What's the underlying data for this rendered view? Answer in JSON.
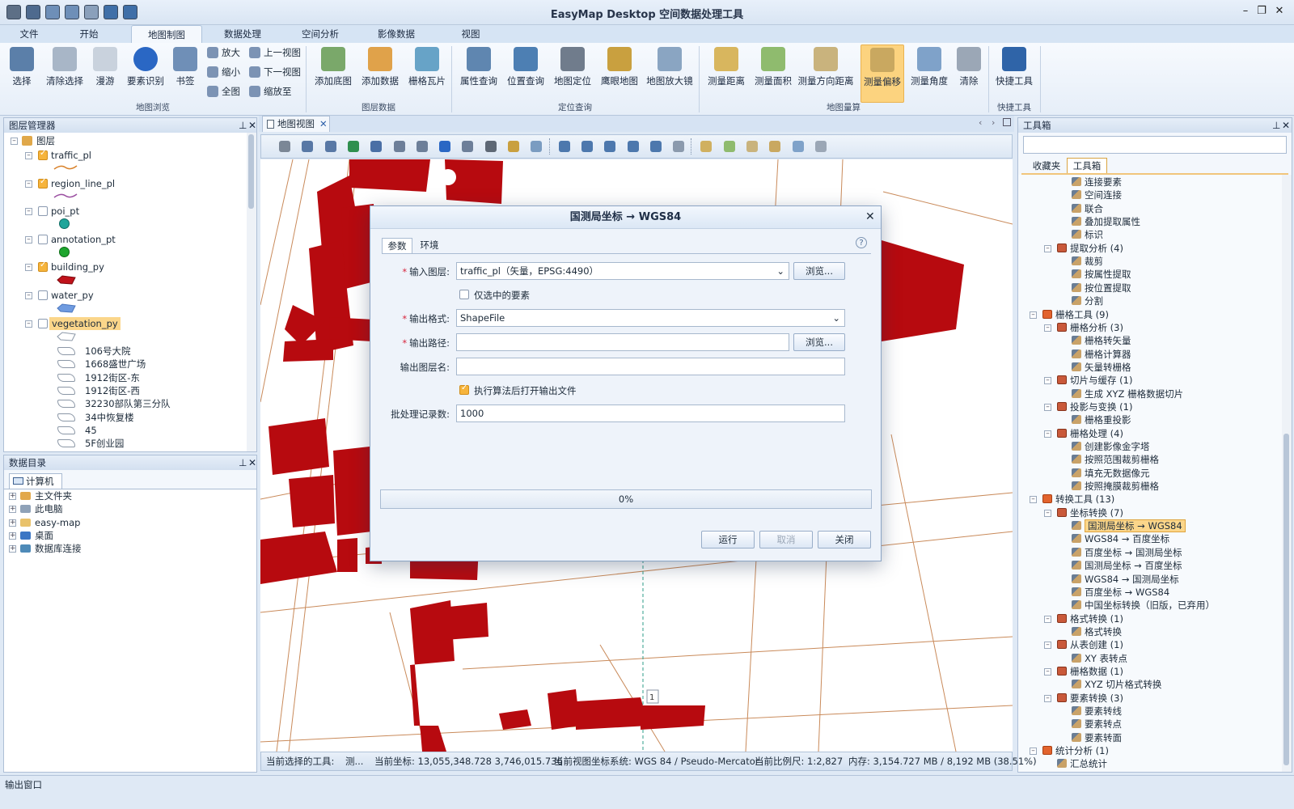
{
  "app": {
    "title": "EasyMap Desktop 空间数据处理工具"
  },
  "ribbon_tabs": [
    "文件",
    "开始",
    "地图制图",
    "数据处理",
    "空间分析",
    "影像数据",
    "视图"
  ],
  "ribbon": {
    "browse_buttons": [
      "选择",
      "清除选择",
      "漫游",
      "要素识别",
      "书签"
    ],
    "small_a": [
      "放大",
      "缩小",
      "全图"
    ],
    "small_b": [
      "上一视图",
      "下一视图",
      "缩放至"
    ],
    "browse_group": "地图浏览",
    "layer_buttons": [
      "添加底图",
      "添加数据",
      "栅格瓦片"
    ],
    "layer_group": "图层数据",
    "locate_buttons": [
      "属性查询",
      "位置查询",
      "地图定位",
      "鹰眼地图",
      "地图放大镜"
    ],
    "locate_group": "定位查询",
    "measure_buttons": [
      "测量距离",
      "测量面积",
      "测量方向距离",
      "测量偏移",
      "测量角度",
      "清除"
    ],
    "measure_group": "地图量算",
    "quick_button": "快捷工具",
    "quick_group": "快捷工具"
  },
  "layer_manager": {
    "title": "图层管理器",
    "root": "图层",
    "layers": [
      "traffic_pl",
      "region_line_pl",
      "poi_pt",
      "annotation_pt",
      "building_py",
      "water_py",
      "vegetation_py"
    ],
    "veg_items": [
      "106号大院",
      "1668盛世广场",
      "1912街区-东",
      "1912街区-西",
      "32230部队第三分队",
      "34中恢复楼",
      "45",
      "5F创业园"
    ]
  },
  "data_catalog": {
    "title": "数据目录",
    "tab": "计算机",
    "items": [
      "主文件夹",
      "此电脑",
      "easy-map",
      "桌面",
      "数据库连接"
    ]
  },
  "map_view": {
    "tab": "地图视图",
    "marker": "1"
  },
  "dialog": {
    "title": "国测局坐标 → WGS84",
    "tabs": [
      "参数",
      "环境"
    ],
    "input_layer_label": "输入图层:",
    "input_layer_value": "traffic_pl（矢量，EPSG:4490）",
    "browse": "浏览...",
    "only_selected": "仅选中的要素",
    "output_format_label": "输出格式:",
    "output_format_value": "ShapeFile",
    "output_path_label": "输出路径:",
    "output_name_label": "输出图层名:",
    "open_after": "执行算法后打开输出文件",
    "batch_label": "批处理记录数:",
    "batch_value": "1000",
    "progress": "0%",
    "run": "运行",
    "cancel": "取消",
    "close": "关闭"
  },
  "toolbox": {
    "title": "工具箱",
    "tabs": [
      "收藏夹",
      "工具箱"
    ],
    "rows": [
      {
        "level": 3,
        "type": "tool",
        "label": "连接要素"
      },
      {
        "level": 3,
        "type": "tool",
        "label": "空间连接"
      },
      {
        "level": 3,
        "type": "tool",
        "label": "联合"
      },
      {
        "level": 3,
        "type": "tool",
        "label": "叠加提取属性"
      },
      {
        "level": 3,
        "type": "tool",
        "label": "标识"
      },
      {
        "level": 2,
        "type": "group",
        "label": "提取分析 (4)"
      },
      {
        "level": 3,
        "type": "tool",
        "label": "裁剪"
      },
      {
        "level": 3,
        "type": "tool",
        "label": "按属性提取"
      },
      {
        "level": 3,
        "type": "tool",
        "label": "按位置提取"
      },
      {
        "level": 3,
        "type": "tool",
        "label": "分割"
      },
      {
        "level": 1,
        "type": "box",
        "label": "栅格工具 (9)"
      },
      {
        "level": 2,
        "type": "group",
        "label": "栅格分析 (3)"
      },
      {
        "level": 3,
        "type": "tool",
        "label": "栅格转矢量"
      },
      {
        "level": 3,
        "type": "tool",
        "label": "栅格计算器"
      },
      {
        "level": 3,
        "type": "tool",
        "label": "矢量转栅格"
      },
      {
        "level": 2,
        "type": "group",
        "label": "切片与缓存 (1)"
      },
      {
        "level": 3,
        "type": "tool",
        "label": "生成 XYZ 栅格数据切片"
      },
      {
        "level": 2,
        "type": "group",
        "label": "投影与变换 (1)"
      },
      {
        "level": 3,
        "type": "tool",
        "label": "栅格重投影"
      },
      {
        "level": 2,
        "type": "group",
        "label": "栅格处理 (4)"
      },
      {
        "level": 3,
        "type": "tool",
        "label": "创建影像金字塔"
      },
      {
        "level": 3,
        "type": "tool",
        "label": "按照范围裁剪栅格"
      },
      {
        "level": 3,
        "type": "tool",
        "label": "填充无数据像元"
      },
      {
        "level": 3,
        "type": "tool",
        "label": "按照掩膜裁剪栅格"
      },
      {
        "level": 1,
        "type": "box",
        "label": "转换工具 (13)"
      },
      {
        "level": 2,
        "type": "group",
        "label": "坐标转换 (7)"
      },
      {
        "level": 3,
        "type": "tool",
        "label": "国测局坐标 → WGS84",
        "selected": true
      },
      {
        "level": 3,
        "type": "tool",
        "label": "WGS84 → 百度坐标"
      },
      {
        "level": 3,
        "type": "tool",
        "label": "百度坐标 → 国测局坐标"
      },
      {
        "level": 3,
        "type": "tool",
        "label": "国测局坐标 → 百度坐标"
      },
      {
        "level": 3,
        "type": "tool",
        "label": "WGS84 → 国测局坐标"
      },
      {
        "level": 3,
        "type": "tool",
        "label": "百度坐标 → WGS84"
      },
      {
        "level": 3,
        "type": "tool",
        "label": "中国坐标转换（旧版，已弃用）"
      },
      {
        "level": 2,
        "type": "group",
        "label": "格式转换 (1)"
      },
      {
        "level": 3,
        "type": "tool",
        "label": "格式转换"
      },
      {
        "level": 2,
        "type": "group",
        "label": "从表创建 (1)"
      },
      {
        "level": 3,
        "type": "tool",
        "label": "XY 表转点"
      },
      {
        "level": 2,
        "type": "group",
        "label": "栅格数据 (1)"
      },
      {
        "level": 3,
        "type": "tool",
        "label": "XYZ 切片格式转换"
      },
      {
        "level": 2,
        "type": "group",
        "label": "要素转换 (3)"
      },
      {
        "level": 3,
        "type": "tool",
        "label": "要素转线"
      },
      {
        "level": 3,
        "type": "tool",
        "label": "要素转点"
      },
      {
        "level": 3,
        "type": "tool",
        "label": "要素转面"
      },
      {
        "level": 1,
        "type": "box",
        "label": "统计分析 (1)"
      },
      {
        "level": 2,
        "type": "tool",
        "label": "汇总统计"
      }
    ]
  },
  "status": {
    "tool": "当前选择的工具:",
    "tool_value": "测...",
    "coord": "当前坐标:  13,055,348.728    3,746,015.736",
    "crs": "当前视图坐标系统: WGS 84 / Pseudo-Mercator",
    "scale": "当前比例尺: 1:2,827",
    "memory": "内存: 3,154.727 MB / 8,192 MB (38.51%)"
  },
  "output_window": "输出窗口",
  "colors": {
    "building": "#b70a0f",
    "road": "#c98a5a",
    "accent": "#f7b739"
  }
}
